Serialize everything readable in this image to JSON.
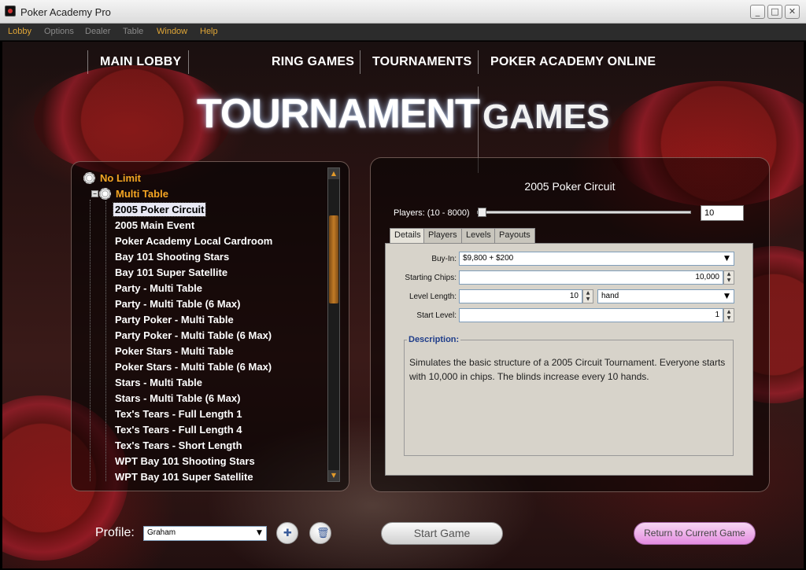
{
  "window": {
    "title": "Poker Academy Pro"
  },
  "menu": [
    "Lobby",
    "Options",
    "Dealer",
    "Table",
    "Window",
    "Help"
  ],
  "nav": {
    "main_lobby": "MAIN LOBBY",
    "ring_games": "RING GAMES",
    "tournaments": "TOURNAMENTS",
    "online": "POKER ACADEMY ONLINE"
  },
  "heading": {
    "primary": "TOURNAMENT",
    "secondary": "GAMES"
  },
  "tree": {
    "root": "No Limit",
    "group": "Multi Table",
    "expander": "−",
    "items": [
      "2005 Poker Circuit",
      "2005 Main Event",
      "Poker Academy Local Cardroom",
      "Bay 101 Shooting Stars",
      "Bay 101 Super Satellite",
      "Party - Multi Table",
      "Party - Multi Table (6 Max)",
      "Party Poker - Multi Table",
      "Party Poker - Multi Table (6 Max)",
      "Poker Stars - Multi Table",
      "Poker Stars - Multi Table (6 Max)",
      "Stars - Multi Table",
      "Stars - Multi Table (6 Max)",
      "Tex's Tears - Full Length 1",
      "Tex's Tears - Full Length 4",
      "Tex's Tears - Short Length",
      "WPT Bay 101 Shooting Stars",
      "WPT Bay 101 Super Satellite"
    ],
    "selected": "2005 Poker Circuit"
  },
  "details": {
    "title": "2005 Poker Circuit",
    "players_label": "Players: (10 - 8000)",
    "players_value": "10",
    "tabs": [
      "Details",
      "Players",
      "Levels",
      "Payouts"
    ],
    "active_tab": "Details",
    "buyin_label": "Buy-In:",
    "buyin_value": "$9,800 + $200",
    "chips_label": "Starting Chips:",
    "chips_value": "10,000",
    "level_length_label": "Level Length:",
    "level_length_value": "10",
    "level_unit": "hand",
    "start_level_label": "Start Level:",
    "start_level_value": "1",
    "description_label": "Description:",
    "description": "Simulates the basic structure of a 2005 Circuit Tournament. Everyone starts with 10,000 in chips. The blinds increase every 10 hands."
  },
  "bottom": {
    "profile_label": "Profile:",
    "profile_value": "Graham",
    "start_button": "Start Game",
    "return_button": "Return to Current Game"
  },
  "icons": {
    "minimize": "minimize-icon",
    "maximize": "maximize-icon",
    "close": "close-icon",
    "new_profile": "new-profile-icon",
    "delete_profile": "trash-icon",
    "chip": "poker-chip-icon"
  },
  "colors": {
    "menu_active": "#e0a637",
    "category": "#f5a623",
    "return_button": "#e48be0"
  }
}
